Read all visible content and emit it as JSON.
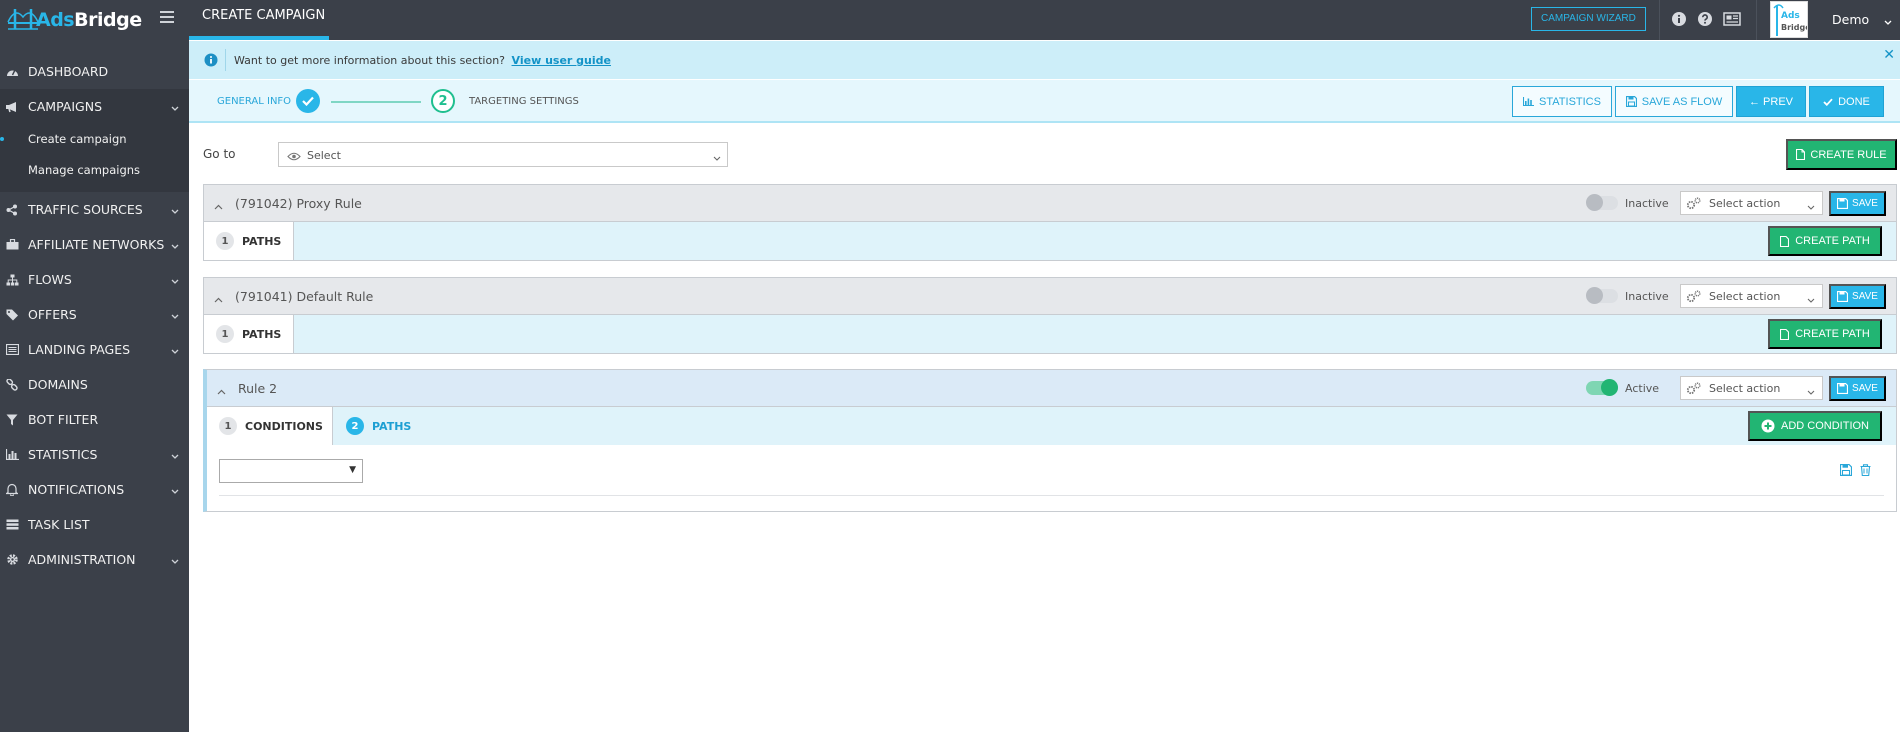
{
  "brand": {
    "part1": "Ads",
    "part2": "Bridge"
  },
  "sidebar": {
    "items": [
      {
        "label": "DASHBOARD"
      },
      {
        "label": "CAMPAIGNS"
      },
      {
        "label": "TRAFFIC SOURCES"
      },
      {
        "label": "AFFILIATE NETWORKS"
      },
      {
        "label": "FLOWS"
      },
      {
        "label": "OFFERS"
      },
      {
        "label": "LANDING PAGES"
      },
      {
        "label": "DOMAINS"
      },
      {
        "label": "BOT FILTER"
      },
      {
        "label": "STATISTICS"
      },
      {
        "label": "NOTIFICATIONS"
      },
      {
        "label": "TASK LIST"
      },
      {
        "label": "ADMINISTRATION"
      }
    ],
    "campaigns_sub": [
      {
        "label": "Create campaign"
      },
      {
        "label": "Manage campaigns"
      }
    ]
  },
  "topbar": {
    "page_title": "CREATE CAMPAIGN",
    "wizard_label": "CAMPAIGN WIZARD",
    "user_name": "Demo",
    "avatar_text1": "Ads",
    "avatar_text2": "Bridge"
  },
  "info": {
    "text": "Want to get more information about this section?",
    "link": "View user guide"
  },
  "steps": {
    "step1": "GENERAL INFO",
    "step2_num": "2",
    "step2": "TARGETING SETTINGS",
    "statistics_label": "STATISTICS",
    "save_flow_label": "SAVE AS FLOW",
    "prev_label": "← PREV",
    "done_label": "DONE"
  },
  "goto": {
    "label": "Go to",
    "value": "Select",
    "create_rule_label": "CREATE RULE"
  },
  "rules": [
    {
      "title": "(791042) Proxy Rule",
      "status": "Inactive",
      "action": "Select action",
      "save": "SAVE",
      "tab_num": "1",
      "tab_label": "PATHS",
      "btn": "CREATE PATH"
    },
    {
      "title": "(791041) Default Rule",
      "status": "Inactive",
      "action": "Select action",
      "save": "SAVE",
      "tab_num": "1",
      "tab_label": "PATHS",
      "btn": "CREATE PATH"
    },
    {
      "title": "Rule 2",
      "status": "Active",
      "action": "Select action",
      "save": "SAVE",
      "tab1_num": "1",
      "tab1_label": "CONDITIONS",
      "tab2_num": "2",
      "tab2_label": "PATHS",
      "btn": "ADD CONDITION",
      "select_value": ""
    }
  ]
}
